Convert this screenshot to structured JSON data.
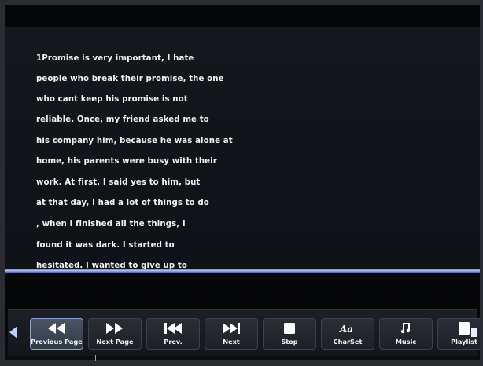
{
  "reader": {
    "lines": [
      "1Promise is very important, I hate",
      "people who break their promise, the one",
      "who cant keep his promise is not",
      "reliable. Once, my friend asked me to",
      "his company him, because he was alone at",
      "home, his parents were busy with their",
      "work. At first, I said yes to him, but",
      "at that day, I had a lot of things to do",
      ", when I finished all the things, I",
      "found it was dark. I started to",
      "hesitated. I wanted to give up to"
    ]
  },
  "toolbar": {
    "buttons": [
      {
        "label": "Previous Page",
        "icon": "previous-page-icon",
        "active": true
      },
      {
        "label": "Next Page",
        "icon": "next-page-icon",
        "active": false
      },
      {
        "label": "Prev.",
        "icon": "previous-track-icon",
        "active": false
      },
      {
        "label": "Next",
        "icon": "next-track-icon",
        "active": false
      },
      {
        "label": "Stop",
        "icon": "stop-icon",
        "active": false
      },
      {
        "label": "CharSet",
        "icon": "charset-icon",
        "active": false
      },
      {
        "label": "Music",
        "icon": "music-icon",
        "active": false
      },
      {
        "label": "Playlist",
        "icon": "playlist-icon",
        "active": false
      }
    ]
  },
  "colors": {
    "text": "#f2f2f2",
    "divider": "#b9c6ff",
    "active_border": "#8aa3d2"
  }
}
